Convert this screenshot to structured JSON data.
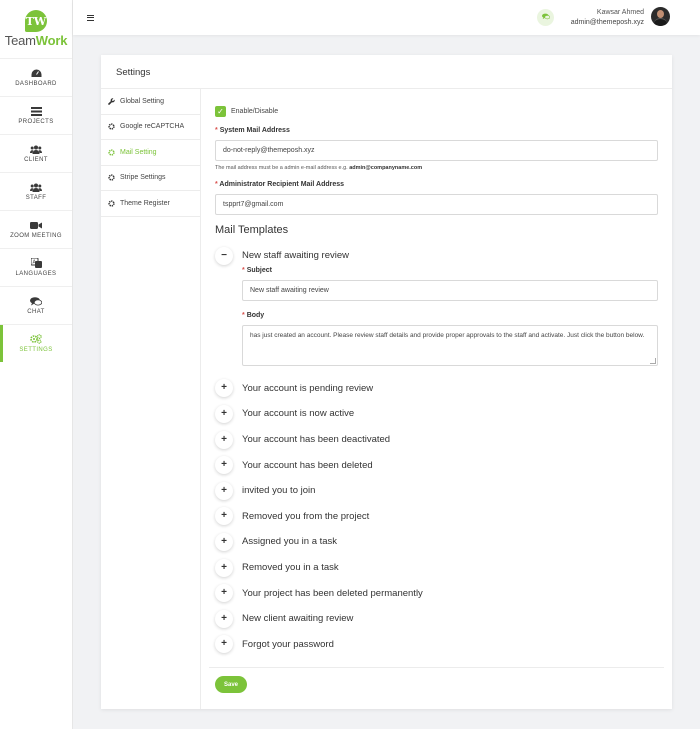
{
  "brand": {
    "badge": "TW",
    "name_part1": "Team",
    "name_part2": "Work",
    "accent_color": "#7cc33a"
  },
  "sidebar": {
    "items": [
      {
        "label": "DASHBOARD",
        "icon": "dashboard-icon"
      },
      {
        "label": "PROJECTS",
        "icon": "list-icon"
      },
      {
        "label": "CLIENT",
        "icon": "users-icon"
      },
      {
        "label": "STAFF",
        "icon": "users-icon"
      },
      {
        "label": "ZOOM MEETING",
        "icon": "video-icon"
      },
      {
        "label": "LANGUAGES",
        "icon": "language-icon"
      },
      {
        "label": "CHAT",
        "icon": "chat-icon"
      },
      {
        "label": "SETTINGS",
        "icon": "gears-icon",
        "active": true
      }
    ]
  },
  "topbar": {
    "user_name": "Kawsar Ahmed",
    "user_email": "admin@themeposh.xyz"
  },
  "settings": {
    "title": "Settings",
    "nav": [
      {
        "label": "Global Setting",
        "icon": "wrench-icon"
      },
      {
        "label": "Google reCAPTCHA",
        "icon": "gear-icon"
      },
      {
        "label": "Mail Setting",
        "icon": "gear-icon",
        "active": true
      },
      {
        "label": "Stripe Settings",
        "icon": "gear-icon"
      },
      {
        "label": "Theme Register",
        "icon": "gear-icon"
      }
    ]
  },
  "mail": {
    "enable_label": "Enable/Disable",
    "system_mail_label": "System Mail Address",
    "system_mail_value": "do-not-reply@themeposh.xyz",
    "hint_prefix": "The mail address must be a admin e-mail address e.g. ",
    "hint_example": "admin@companyname.com",
    "admin_mail_label": "Administrator Recipient Mail Address",
    "admin_mail_value": "tspprt7@gmail.com",
    "templates_title": "Mail Templates",
    "open_template": {
      "title": "New staff awaiting review",
      "subject_label": "Subject",
      "subject_value": "New staff awaiting review",
      "body_label": "Body",
      "body_value": "has just created an account. Please review staff details and provide proper approvals to the staff and activate. Just click the button below."
    },
    "templates": [
      "Your account is pending review",
      "Your account is now active",
      "Your account has been deactivated",
      "Your account has been deleted",
      "invited you to join",
      "Removed you from the project",
      "Assigned you in a task",
      "Removed you in a task",
      "Your project has been deleted permanently",
      "New client awaiting review",
      "Forgot your password"
    ],
    "save_label": "Save",
    "required_marker": "*",
    "collapse_symbol": "−",
    "expand_symbol": "+"
  }
}
